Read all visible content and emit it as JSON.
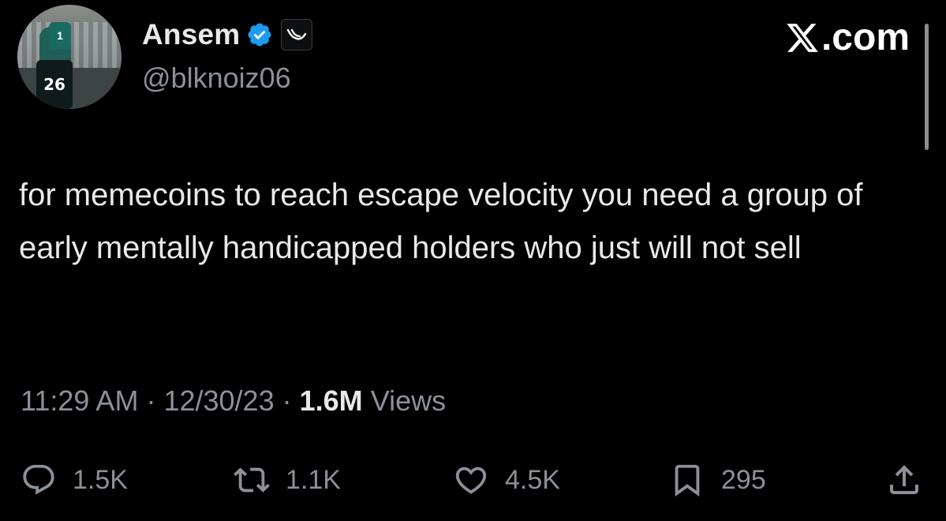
{
  "author": {
    "display_name": "Ansem",
    "handle": "@blknoiz06",
    "avatar_jersey_number": "26",
    "avatar_jersey_top": "1",
    "verified": true
  },
  "brand": {
    "text": ".com",
    "icon": "x-logo-icon"
  },
  "tweet": {
    "text": "for memecoins to reach escape velocity you need a group of early mentally handicapped holders who just will not sell"
  },
  "meta": {
    "time": "11:29 AM",
    "separator": "·",
    "date": "12/30/23",
    "views_count": "1.6M",
    "views_label": "Views"
  },
  "actions": {
    "replies": "1.5K",
    "reposts": "1.1K",
    "likes": "4.5K",
    "bookmarks": "295"
  },
  "colors": {
    "background": "#000000",
    "text_primary": "#e7e9ea",
    "text_secondary": "#8b9197",
    "verified_blue": "#1d9bf0"
  }
}
